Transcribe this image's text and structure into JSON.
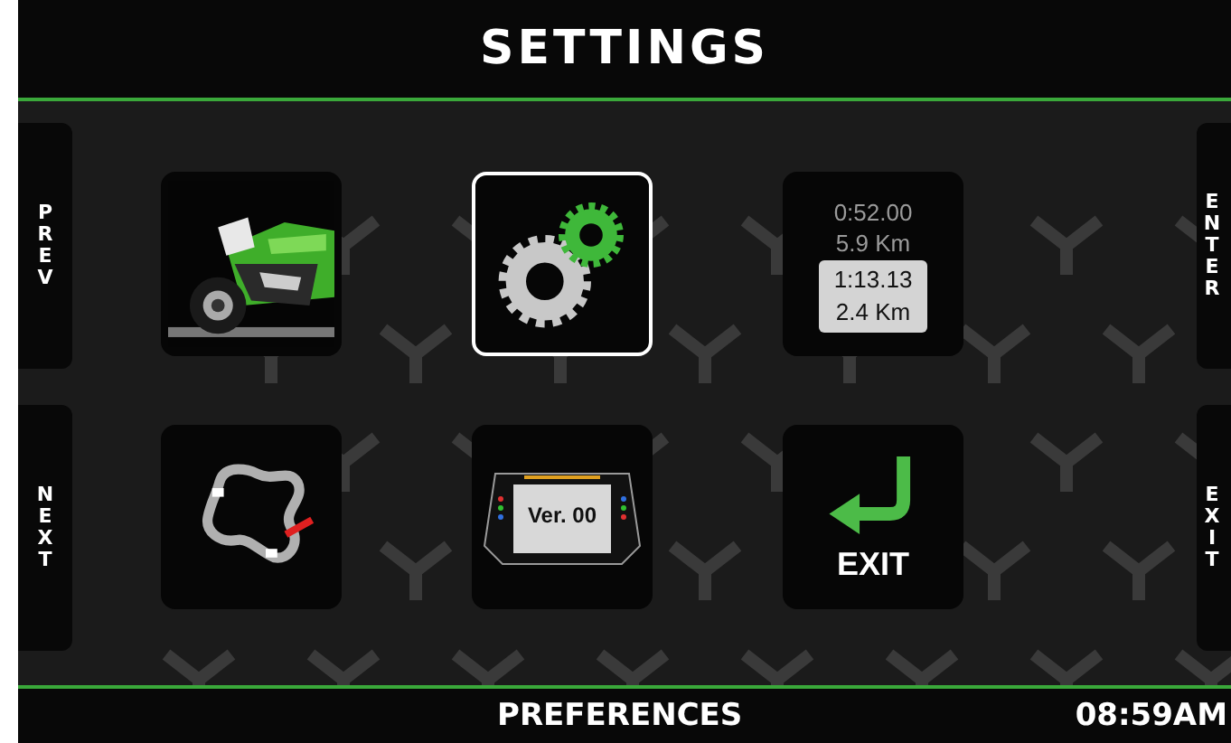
{
  "header": {
    "title": "SETTINGS"
  },
  "left_buttons": [
    {
      "label": "PREV"
    },
    {
      "label": "NEXT"
    }
  ],
  "right_buttons": [
    {
      "label": "ENTER"
    },
    {
      "label": "EXIT"
    }
  ],
  "tiles": [
    {
      "kind": "picture",
      "selected": false
    },
    {
      "kind": "gears",
      "selected": true
    },
    {
      "kind": "laps",
      "selected": false,
      "lines": [
        "0:52.00",
        "5.9 Km"
      ],
      "highlight": [
        "1:13.13",
        "2.4 Km"
      ]
    },
    {
      "kind": "track",
      "selected": false
    },
    {
      "kind": "device",
      "selected": false,
      "label": "Ver. 00"
    },
    {
      "kind": "exit",
      "selected": false,
      "label": "EXIT"
    }
  ],
  "footer": {
    "label": "PREFERENCES",
    "time": "08:59AM"
  }
}
